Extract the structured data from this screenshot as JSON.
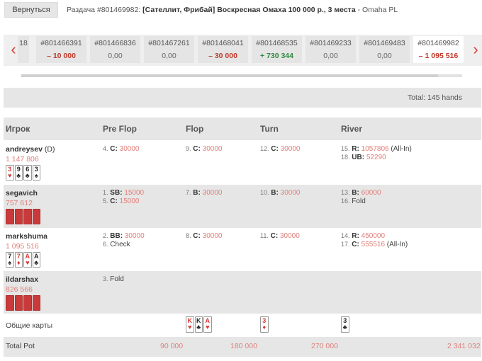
{
  "header": {
    "back_label": "Вернуться",
    "title_prefix": "Раздача #801469982:",
    "title_bold": "[Сателлит, Фрибай] Воскресная Омаха 100 000 р., 3 места",
    "title_suffix": "- Omaha PL"
  },
  "hands_strip": {
    "prev_icon": "chevron-left-icon",
    "next_icon": "chevron-right-icon",
    "partial_label": "18",
    "hands": [
      {
        "id": "#801466391",
        "value": "– 10 000",
        "kind": "neg"
      },
      {
        "id": "#801466836",
        "value": "0,00",
        "kind": "zero"
      },
      {
        "id": "#801467261",
        "value": "0,00",
        "kind": "zero"
      },
      {
        "id": "#801468041",
        "value": "– 30 000",
        "kind": "neg"
      },
      {
        "id": "#801468535",
        "value": "+ 730 344",
        "kind": "pos"
      },
      {
        "id": "#801469233",
        "value": "0,00",
        "kind": "zero"
      },
      {
        "id": "#801469483",
        "value": "0,00",
        "kind": "zero"
      },
      {
        "id": "#801469982",
        "value": "– 1 095 516",
        "kind": "neg",
        "active": true
      }
    ]
  },
  "total_hands": "Total: 145 hands",
  "table": {
    "headers": {
      "player": "Игрок",
      "preflop": "Pre Flop",
      "flop": "Flop",
      "turn": "Turn",
      "river": "River"
    },
    "players": [
      {
        "name": "andreysev",
        "dealer": "(D)",
        "stack": "1 147 806",
        "cards": [
          {
            "r": "3",
            "s": "♥",
            "c": "red"
          },
          {
            "r": "9",
            "s": "♣",
            "c": "black"
          },
          {
            "r": "6",
            "s": "♣",
            "c": "black"
          },
          {
            "r": "3",
            "s": "♠",
            "c": "black"
          }
        ],
        "preflop": [
          {
            "n": "4.",
            "t": "C:",
            "amt": "30000"
          }
        ],
        "flop": [
          {
            "n": "9.",
            "t": "C:",
            "amt": "30000"
          }
        ],
        "turn": [
          {
            "n": "12.",
            "t": "C:",
            "amt": "30000"
          }
        ],
        "river": [
          {
            "n": "15.",
            "t": "R:",
            "amt": "1057806",
            "extra": "(All-In)"
          },
          {
            "n": "18.",
            "t": "UB:",
            "amt": "52290"
          }
        ]
      },
      {
        "name": "segavich",
        "stack": "757 612",
        "hidden_cards": 4,
        "preflop": [
          {
            "n": "1.",
            "t": "SB:",
            "amt": "15000"
          },
          {
            "n": "5.",
            "t": "C:",
            "amt": "15000"
          }
        ],
        "flop": [
          {
            "n": "7.",
            "t": "B:",
            "amt": "30000"
          }
        ],
        "turn": [
          {
            "n": "10.",
            "t": "B:",
            "amt": "30000"
          }
        ],
        "river": [
          {
            "n": "13.",
            "t": "B:",
            "amt": "60000"
          },
          {
            "n": "16.",
            "plain": "Fold"
          }
        ]
      },
      {
        "name": "markshuma",
        "stack": "1 095 516",
        "cards": [
          {
            "r": "7",
            "s": "♠",
            "c": "black"
          },
          {
            "r": "7",
            "s": "♦",
            "c": "red"
          },
          {
            "r": "A",
            "s": "♥",
            "c": "red"
          },
          {
            "r": "A",
            "s": "♣",
            "c": "black"
          }
        ],
        "preflop": [
          {
            "n": "2.",
            "t": "BB:",
            "amt": "30000"
          },
          {
            "n": "6.",
            "plain": "Check"
          }
        ],
        "flop": [
          {
            "n": "8.",
            "t": "C:",
            "amt": "30000"
          }
        ],
        "turn": [
          {
            "n": "11.",
            "t": "C:",
            "amt": "30000"
          }
        ],
        "river": [
          {
            "n": "14.",
            "t": "R:",
            "amt": "450000"
          },
          {
            "n": "17.",
            "t": "C:",
            "amt": "555516",
            "extra": "(All-In)"
          }
        ]
      },
      {
        "name": "ildarshax",
        "stack": "826 566",
        "hidden_cards": 4,
        "preflop": [
          {
            "n": "3.",
            "plain": "Fold"
          }
        ],
        "flop": [],
        "turn": [],
        "river": []
      }
    ],
    "board": {
      "label": "Общие карты",
      "flop": [
        {
          "r": "K",
          "s": "♥",
          "c": "red"
        },
        {
          "r": "K",
          "s": "♣",
          "c": "black"
        },
        {
          "r": "A",
          "s": "♥",
          "c": "red"
        }
      ],
      "turn": [
        {
          "r": "3",
          "s": "♦",
          "c": "red"
        }
      ],
      "river": [
        {
          "r": "3",
          "s": "♣",
          "c": "black"
        }
      ]
    },
    "pot": {
      "label": "Total Pot",
      "preflop": "90 000",
      "flop": "180 000",
      "turn": "270 000",
      "river": "2 341 032"
    }
  },
  "colors": {
    "accent": "#d93a35",
    "amount": "#e0807a",
    "positive": "#2f8a3c"
  }
}
